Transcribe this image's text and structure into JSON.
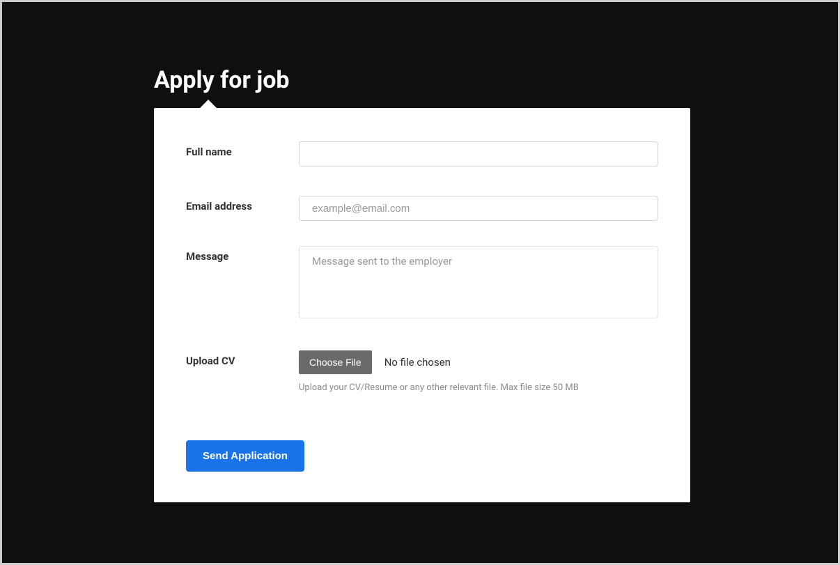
{
  "page": {
    "title": "Apply for job"
  },
  "form": {
    "fullname": {
      "label": "Full name",
      "value": ""
    },
    "email": {
      "label": "Email address",
      "placeholder": "example@email.com",
      "value": ""
    },
    "message": {
      "label": "Message",
      "placeholder": "Message sent to the employer",
      "value": ""
    },
    "upload": {
      "label": "Upload CV",
      "choose_button": "Choose File",
      "no_file_text": "No file chosen",
      "hint": "Upload your CV/Resume or any other relevant file. Max file size 50 MB"
    },
    "submit_label": "Send Application"
  }
}
